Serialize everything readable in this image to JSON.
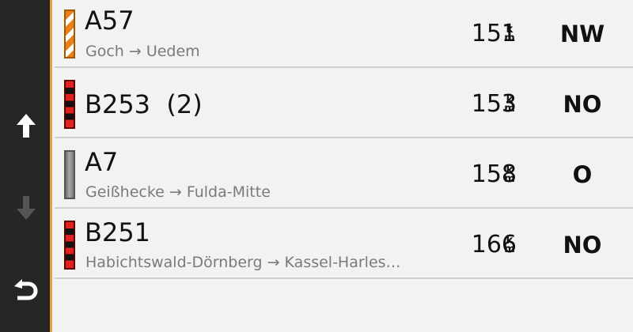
{
  "sidebar": {
    "buttons": [
      {
        "name": "scroll-up",
        "icon": "arrow-up-icon",
        "enabled": true
      },
      {
        "name": "scroll-down",
        "icon": "arrow-down-icon",
        "enabled": false
      },
      {
        "name": "back",
        "icon": "back-icon",
        "enabled": true
      }
    ],
    "accent_color": "#e8a33c"
  },
  "rows": [
    {
      "road": "A57",
      "route": "Goch → Uedem",
      "distance": "151",
      "unit_top": "k",
      "unit_bottom": "m",
      "direction": "NW",
      "indicator": "construction"
    },
    {
      "road": "B253  (2)",
      "route": "",
      "distance": "153",
      "unit_top": "k",
      "unit_bottom": "m",
      "direction": "NO",
      "indicator": "jam"
    },
    {
      "road": "A7",
      "route": "Geißhecke → Fulda-Mitte",
      "distance": "158",
      "unit_top": "k",
      "unit_bottom": "m",
      "direction": "O",
      "indicator": "none"
    },
    {
      "road": "B251",
      "route": "Habichtswald-Dörnberg → Kassel-Harles…",
      "distance": "166",
      "unit_top": "k",
      "unit_bottom": "m",
      "direction": "NO",
      "indicator": "jam"
    }
  ]
}
